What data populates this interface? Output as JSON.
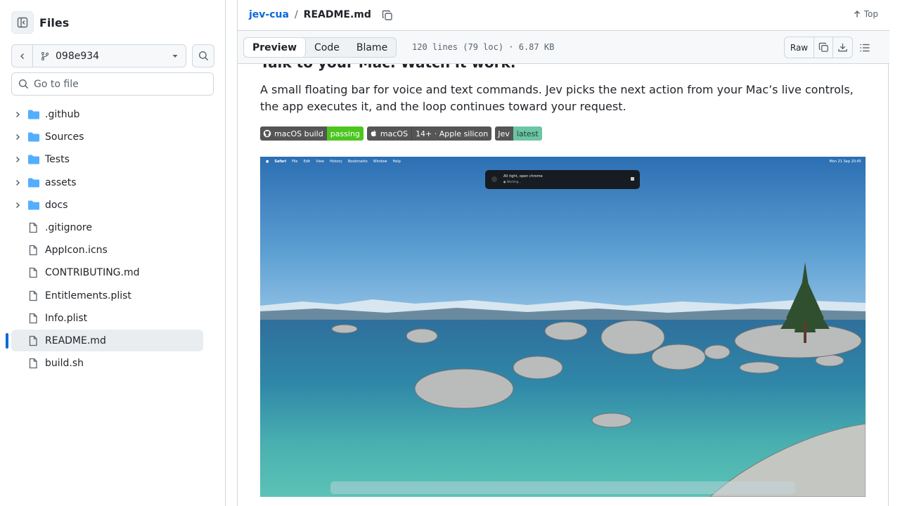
{
  "sidebar": {
    "title": "Files",
    "branch": "098e934",
    "goto_placeholder": "Go to file",
    "items": [
      {
        "name": ".github",
        "type": "folder"
      },
      {
        "name": "Sources",
        "type": "folder"
      },
      {
        "name": "Tests",
        "type": "folder"
      },
      {
        "name": "assets",
        "type": "folder"
      },
      {
        "name": "docs",
        "type": "folder"
      },
      {
        "name": ".gitignore",
        "type": "file"
      },
      {
        "name": "AppIcon.icns",
        "type": "file"
      },
      {
        "name": "CONTRIBUTING.md",
        "type": "file"
      },
      {
        "name": "Entitlements.plist",
        "type": "file"
      },
      {
        "name": "Info.plist",
        "type": "file"
      },
      {
        "name": "README.md",
        "type": "file",
        "selected": true
      },
      {
        "name": "build.sh",
        "type": "file"
      }
    ]
  },
  "header": {
    "repo": "jev-cua",
    "separator": "/",
    "file": "README.md",
    "top_label": "Top"
  },
  "filebar": {
    "tabs": [
      "Preview",
      "Code",
      "Blame"
    ],
    "active_tab": "Preview",
    "info": "120 lines (79 loc) · 6.87 KB",
    "raw_label": "Raw"
  },
  "readme": {
    "heading": "Talk to your Mac. Watch it work.",
    "description": "A small floating bar for voice and text commands. Jev picks the next action from your Mac’s live controls, the app executes it, and the loop continues toward your request.",
    "badges": [
      {
        "left": "macOS build",
        "right": "passing",
        "color": "#4cc61e",
        "icon": "github-icon"
      },
      {
        "left": "macOS",
        "right": "14+ · Apple silicon",
        "color": "#555555",
        "icon": "apple-icon"
      },
      {
        "left": "Jev",
        "right": "latest",
        "color": "#6cc5a5",
        "icon": ""
      }
    ],
    "screenshot": {
      "menu": [
        "Safari",
        "File",
        "Edit",
        "View",
        "History",
        "Bookmarks",
        "Window",
        "Help"
      ],
      "clock": "Mon 21 Sep 20:45",
      "notification_title": "All right, open chrome",
      "notification_status": "● Working..."
    }
  },
  "colors": {
    "link": "#0969da",
    "border": "#d0d7de",
    "muted": "#59636e"
  }
}
